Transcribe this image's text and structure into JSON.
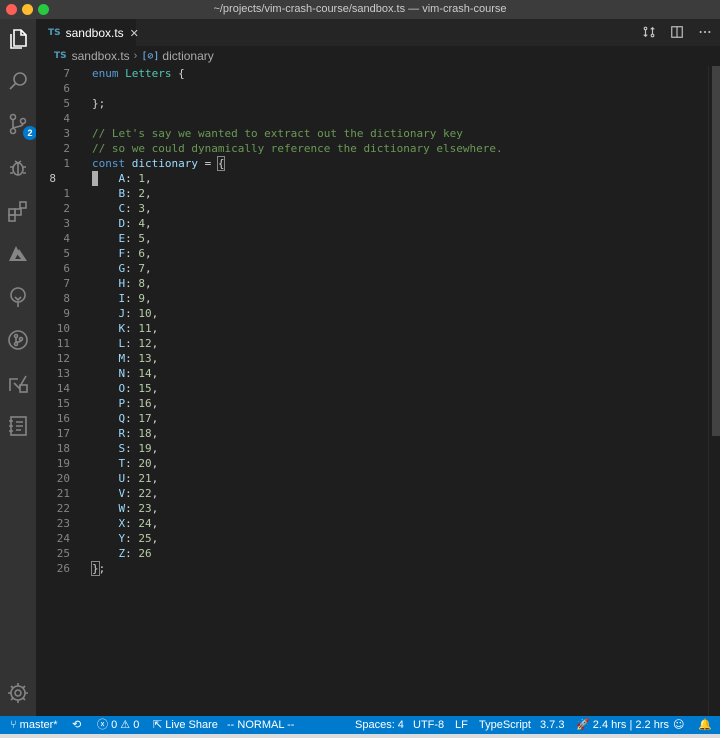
{
  "window": {
    "title": "~/projects/vim-crash-course/sandbox.ts — vim-crash-course"
  },
  "activity_bar": [
    {
      "icon": "files-icon"
    },
    {
      "icon": "search-icon"
    },
    {
      "icon": "source-control-icon",
      "badge": "2"
    },
    {
      "icon": "debug-icon"
    },
    {
      "icon": "extensions-icon"
    },
    {
      "icon": "azure-icon"
    },
    {
      "icon": "tree-icon"
    },
    {
      "icon": "git-graph-icon"
    },
    {
      "icon": "remote-explorer-icon"
    },
    {
      "icon": "notebook-icon"
    },
    {
      "icon": "settings-gear-icon"
    }
  ],
  "tab": {
    "lang": "TS",
    "label": "sandbox.ts",
    "close": "✕"
  },
  "breadcrumb": {
    "lang": "TS",
    "file": "sandbox.ts",
    "symbol_icon": "[⊘]",
    "symbol": "dictionary"
  },
  "editor": {
    "lines": [
      {
        "num": "7",
        "tokens": [
          {
            "t": "enum ",
            "c": "kw"
          },
          {
            "t": "Letters",
            "c": "ty"
          },
          {
            "t": " {",
            "c": "pn"
          }
        ]
      },
      {
        "num": "6",
        "tokens": []
      },
      {
        "num": "5",
        "tokens": [
          {
            "t": "};",
            "c": "pn"
          }
        ]
      },
      {
        "num": "4",
        "tokens": []
      },
      {
        "num": "3",
        "tokens": [
          {
            "t": "// Let's say we wanted to extract out the dictionary key",
            "c": "cm"
          }
        ]
      },
      {
        "num": "2",
        "tokens": [
          {
            "t": "// so we could dynamically reference the dictionary elsewhere.",
            "c": "cm"
          }
        ]
      },
      {
        "num": "1",
        "tokens": [
          {
            "t": "const ",
            "c": "kw"
          },
          {
            "t": "dictionary",
            "c": "var"
          },
          {
            "t": " = ",
            "c": "pn"
          },
          {
            "t": "{",
            "c": "pn",
            "box": true
          }
        ]
      },
      {
        "num": "8",
        "current": true,
        "tokens": [
          {
            "t": "    "
          },
          {
            "t": "A",
            "c": "var"
          },
          {
            "t": ": "
          },
          {
            "t": "1",
            "c": "num"
          },
          {
            "t": ","
          }
        ]
      },
      {
        "num": "1",
        "tokens": [
          {
            "t": "    "
          },
          {
            "t": "B",
            "c": "var"
          },
          {
            "t": ": "
          },
          {
            "t": "2",
            "c": "num"
          },
          {
            "t": ","
          }
        ]
      },
      {
        "num": "2",
        "tokens": [
          {
            "t": "    "
          },
          {
            "t": "C",
            "c": "var"
          },
          {
            "t": ": "
          },
          {
            "t": "3",
            "c": "num"
          },
          {
            "t": ","
          }
        ]
      },
      {
        "num": "3",
        "tokens": [
          {
            "t": "    "
          },
          {
            "t": "D",
            "c": "var"
          },
          {
            "t": ": "
          },
          {
            "t": "4",
            "c": "num"
          },
          {
            "t": ","
          }
        ]
      },
      {
        "num": "4",
        "tokens": [
          {
            "t": "    "
          },
          {
            "t": "E",
            "c": "var"
          },
          {
            "t": ": "
          },
          {
            "t": "5",
            "c": "num"
          },
          {
            "t": ","
          }
        ]
      },
      {
        "num": "5",
        "tokens": [
          {
            "t": "    "
          },
          {
            "t": "F",
            "c": "var"
          },
          {
            "t": ": "
          },
          {
            "t": "6",
            "c": "num"
          },
          {
            "t": ","
          }
        ]
      },
      {
        "num": "6",
        "tokens": [
          {
            "t": "    "
          },
          {
            "t": "G",
            "c": "var"
          },
          {
            "t": ": "
          },
          {
            "t": "7",
            "c": "num"
          },
          {
            "t": ","
          }
        ]
      },
      {
        "num": "7",
        "tokens": [
          {
            "t": "    "
          },
          {
            "t": "H",
            "c": "var"
          },
          {
            "t": ": "
          },
          {
            "t": "8",
            "c": "num"
          },
          {
            "t": ","
          }
        ]
      },
      {
        "num": "8",
        "tokens": [
          {
            "t": "    "
          },
          {
            "t": "I",
            "c": "var"
          },
          {
            "t": ": "
          },
          {
            "t": "9",
            "c": "num"
          },
          {
            "t": ","
          }
        ]
      },
      {
        "num": "9",
        "tokens": [
          {
            "t": "    "
          },
          {
            "t": "J",
            "c": "var"
          },
          {
            "t": ": "
          },
          {
            "t": "10",
            "c": "num"
          },
          {
            "t": ","
          }
        ]
      },
      {
        "num": "10",
        "tokens": [
          {
            "t": "    "
          },
          {
            "t": "K",
            "c": "var"
          },
          {
            "t": ": "
          },
          {
            "t": "11",
            "c": "num"
          },
          {
            "t": ","
          }
        ]
      },
      {
        "num": "11",
        "tokens": [
          {
            "t": "    "
          },
          {
            "t": "L",
            "c": "var"
          },
          {
            "t": ": "
          },
          {
            "t": "12",
            "c": "num"
          },
          {
            "t": ","
          }
        ]
      },
      {
        "num": "12",
        "tokens": [
          {
            "t": "    "
          },
          {
            "t": "M",
            "c": "var"
          },
          {
            "t": ": "
          },
          {
            "t": "13",
            "c": "num"
          },
          {
            "t": ","
          }
        ]
      },
      {
        "num": "13",
        "tokens": [
          {
            "t": "    "
          },
          {
            "t": "N",
            "c": "var"
          },
          {
            "t": ": "
          },
          {
            "t": "14",
            "c": "num"
          },
          {
            "t": ","
          }
        ]
      },
      {
        "num": "14",
        "tokens": [
          {
            "t": "    "
          },
          {
            "t": "O",
            "c": "var"
          },
          {
            "t": ": "
          },
          {
            "t": "15",
            "c": "num"
          },
          {
            "t": ","
          }
        ]
      },
      {
        "num": "15",
        "tokens": [
          {
            "t": "    "
          },
          {
            "t": "P",
            "c": "var"
          },
          {
            "t": ": "
          },
          {
            "t": "16",
            "c": "num"
          },
          {
            "t": ","
          }
        ]
      },
      {
        "num": "16",
        "tokens": [
          {
            "t": "    "
          },
          {
            "t": "Q",
            "c": "var"
          },
          {
            "t": ": "
          },
          {
            "t": "17",
            "c": "num"
          },
          {
            "t": ","
          }
        ]
      },
      {
        "num": "17",
        "tokens": [
          {
            "t": "    "
          },
          {
            "t": "R",
            "c": "var"
          },
          {
            "t": ": "
          },
          {
            "t": "18",
            "c": "num"
          },
          {
            "t": ","
          }
        ]
      },
      {
        "num": "18",
        "tokens": [
          {
            "t": "    "
          },
          {
            "t": "S",
            "c": "var"
          },
          {
            "t": ": "
          },
          {
            "t": "19",
            "c": "num"
          },
          {
            "t": ","
          }
        ]
      },
      {
        "num": "19",
        "tokens": [
          {
            "t": "    "
          },
          {
            "t": "T",
            "c": "var"
          },
          {
            "t": ": "
          },
          {
            "t": "20",
            "c": "num"
          },
          {
            "t": ","
          }
        ]
      },
      {
        "num": "20",
        "tokens": [
          {
            "t": "    "
          },
          {
            "t": "U",
            "c": "var"
          },
          {
            "t": ": "
          },
          {
            "t": "21",
            "c": "num"
          },
          {
            "t": ","
          }
        ]
      },
      {
        "num": "21",
        "tokens": [
          {
            "t": "    "
          },
          {
            "t": "V",
            "c": "var"
          },
          {
            "t": ": "
          },
          {
            "t": "22",
            "c": "num"
          },
          {
            "t": ","
          }
        ]
      },
      {
        "num": "22",
        "tokens": [
          {
            "t": "    "
          },
          {
            "t": "W",
            "c": "var"
          },
          {
            "t": ": "
          },
          {
            "t": "23",
            "c": "num"
          },
          {
            "t": ","
          }
        ]
      },
      {
        "num": "23",
        "tokens": [
          {
            "t": "    "
          },
          {
            "t": "X",
            "c": "var"
          },
          {
            "t": ": "
          },
          {
            "t": "24",
            "c": "num"
          },
          {
            "t": ","
          }
        ]
      },
      {
        "num": "24",
        "tokens": [
          {
            "t": "    "
          },
          {
            "t": "Y",
            "c": "var"
          },
          {
            "t": ": "
          },
          {
            "t": "25",
            "c": "num"
          },
          {
            "t": ","
          }
        ]
      },
      {
        "num": "25",
        "tokens": [
          {
            "t": "    "
          },
          {
            "t": "Z",
            "c": "var"
          },
          {
            "t": ": "
          },
          {
            "t": "26",
            "c": "num"
          }
        ]
      },
      {
        "num": "26",
        "tokens": [
          {
            "t": "}",
            "c": "pn",
            "box": true
          },
          {
            "t": ";",
            "c": "pn"
          }
        ]
      }
    ]
  },
  "status_bar": {
    "branch_icon": "⑂",
    "branch": "master*",
    "sync_icon": "⟲",
    "errors_icon": "ⓧ",
    "errors": "0",
    "warnings_icon": "⚠",
    "warnings": "0",
    "live_share_icon": "⇱",
    "live_share": "Live Share",
    "vim_mode": "-- NORMAL --",
    "spaces": "Spaces: 4",
    "encoding": "UTF-8",
    "eol": "LF",
    "language": "TypeScript",
    "ts_version": "3.7.3",
    "wakatime_icon": "🚀",
    "wakatime": "2.4 hrs | 2.2 hrs",
    "feedback_icon": "☺",
    "bell_icon": "🔔"
  },
  "colors": {
    "accent": "#007acc",
    "editor_bg": "#1e1e1e",
    "keyword": "#569cd6",
    "type": "#4ec9b0",
    "variable": "#9cdcfe",
    "number": "#b5cea8",
    "comment": "#6a9955"
  }
}
